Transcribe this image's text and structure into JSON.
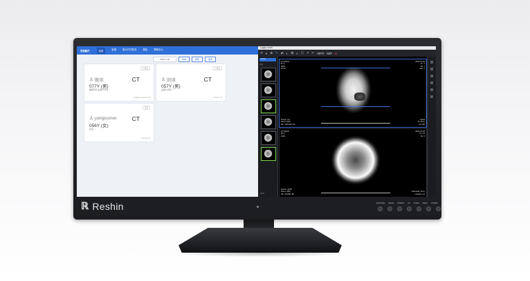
{
  "colors": {
    "accent": "#2f6fd8",
    "viewer_bg": "#000000",
    "selected_border": "#7bd64a"
  },
  "brand": {
    "logo_glyph": "ℝ",
    "name": "Reshin"
  },
  "monitor_controls": [
    "ENHANCE",
    "IMAGE",
    "PRESET",
    "UP",
    "DOWN",
    "MENU",
    "POWER"
  ],
  "worklist": {
    "app_name": "京润医疗",
    "nav": [
      "检查",
      "影像",
      "胶片打印任务",
      "报告",
      "帮助中心"
    ],
    "date": "2024-1-18",
    "buttons": [
      "查询",
      "重置",
      "更多"
    ],
    "cards": [
      {
        "tag": "已签发",
        "name": "陈华",
        "age": "077Y (男)",
        "modality": "CT",
        "desc": "胸部平扫 头颅CT平扫 ...",
        "footer": "检查时间 2024-01-18"
      },
      {
        "tag": "已签发",
        "name": "刘洋",
        "age": "057Y (男)",
        "modality": "CT",
        "desc": "头颅CT平扫 ...",
        "footer": "2024-01-18"
      },
      {
        "tag": "待审",
        "name": "yangsumei",
        "age": "056Y (女)",
        "modality": "CT",
        "desc": "头部",
        "footer": "2024-01-18"
      }
    ]
  },
  "viewer": {
    "title": "京润医疗 3D/2D",
    "tools": [
      "↺",
      "⌖",
      "⊕",
      "✎",
      "⇄",
      "◐",
      "⊞",
      "⌕",
      "☐",
      "↗",
      "✂",
      "MPR",
      "MIP",
      "⏺"
    ],
    "series_panel": {
      "header": "Series",
      "label": "序列",
      "footer": "10:15"
    },
    "vp1": {
      "tl": "CT HEAD\n8Y F\n2024\n10:15",
      "tr": "2024-01-18\nIm: 1\nSe: 1\nAcq: 1",
      "bl": "Frame: 1/1\nZoom: 50%\nWL: 400 WW: 40",
      "br": "Spiral\nTh: 5mm\nkV 120"
    },
    "vp2": {
      "tl": "CT HEAD\n8Y F\nAxial",
      "tr": "2024-01-18\nIm: 12\nSe: 2",
      "bl": "Frame: 12/30\nZoom: 95%\nWL: 40 WW: 80",
      "br": "Thickness: 5mm\nLocation: 12"
    }
  }
}
